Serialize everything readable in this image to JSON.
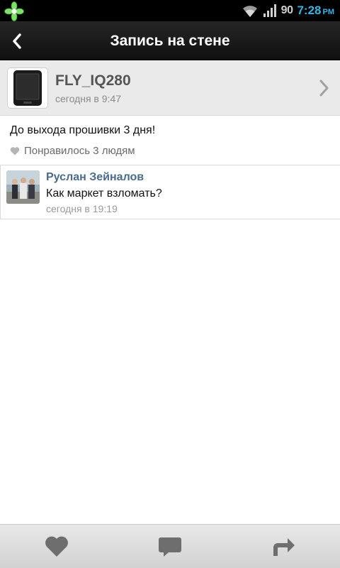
{
  "status_bar": {
    "battery": "90",
    "time": "7:28",
    "ampm": "PM"
  },
  "header": {
    "title": "Запись на стене"
  },
  "profile": {
    "name": "FLY_IQ280",
    "time": "сегодня в 9:47"
  },
  "post": {
    "text": "До выхода прошивки 3 дня!",
    "likes": "Понравилось 3 людям"
  },
  "comment": {
    "author": "Руслан Зейналов",
    "text": "Как маркет взломать?",
    "time": "сегодня в 19:19"
  },
  "toolbar": {
    "icons": [
      "heart-icon",
      "comment-icon",
      "share-icon"
    ]
  },
  "colors": {
    "accent_clock": "#33b5e5",
    "author_link": "#496b8c"
  }
}
